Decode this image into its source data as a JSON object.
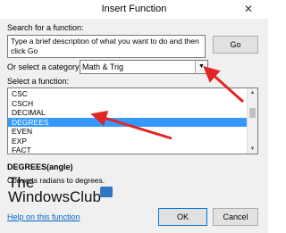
{
  "window": {
    "title": "Insert Function",
    "close_glyph": "✕"
  },
  "search": {
    "label": "Search for a function:",
    "value": "Type a brief description of what you want to do and then click Go",
    "go_label": "Go"
  },
  "category": {
    "label": "Or select a category:",
    "selected": "Math & Trig"
  },
  "functions": {
    "label": "Select a function:",
    "items": [
      "CSC",
      "CSCH",
      "DECIMAL",
      "DEGREES",
      "EVEN",
      "EXP",
      "FACT"
    ],
    "selected_index": 3
  },
  "details": {
    "signature": "DEGREES(angle)",
    "description": "Converts radians to degrees."
  },
  "watermark": {
    "line1": "The",
    "line2": "WindowsClub"
  },
  "footer": {
    "help_link": "Help on this function",
    "ok_label": "OK",
    "cancel_label": "Cancel"
  },
  "colors": {
    "selection": "#3399ff",
    "arrow": "#e32424",
    "dialog_bg": "#f0f0f0"
  }
}
